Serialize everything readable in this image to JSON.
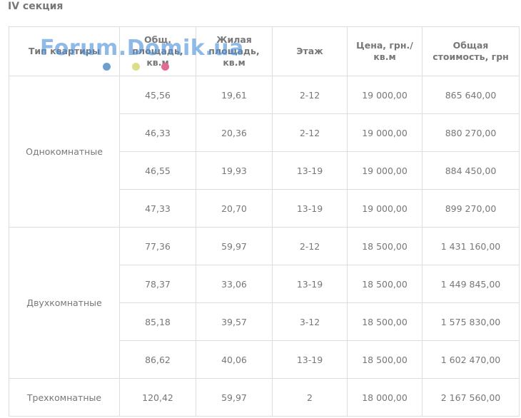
{
  "section_title": "IV секция",
  "watermark": "Forum.Domik.ua",
  "headers": {
    "type": "Тип квартиры",
    "total_area": "Общ. площадь, кв.м",
    "living_area": "Жилая площадь, кв.м",
    "floor": "Этаж",
    "price": "Цена, грн./ кв.м",
    "total_cost": "Общая стоимость, грн"
  },
  "groups": [
    {
      "type": "Однокомнатные",
      "rows": [
        {
          "total_area": "45,56",
          "living_area": "19,61",
          "floor": "2-12",
          "price": "19 000,00",
          "total_cost": "865 640,00"
        },
        {
          "total_area": "46,33",
          "living_area": "20,36",
          "floor": "2-12",
          "price": "19 000,00",
          "total_cost": "880 270,00"
        },
        {
          "total_area": "46,55",
          "living_area": "19,93",
          "floor": "13-19",
          "price": "19 000,00",
          "total_cost": "884 450,00"
        },
        {
          "total_area": "47,33",
          "living_area": "20,70",
          "floor": "13-19",
          "price": "19 000,00",
          "total_cost": "899 270,00"
        }
      ]
    },
    {
      "type": "Двухкомнатные",
      "rows": [
        {
          "total_area": "77,36",
          "living_area": "59,97",
          "floor": "2-12",
          "price": "18 500,00",
          "total_cost": "1 431 160,00"
        },
        {
          "total_area": "78,37",
          "living_area": "33,06",
          "floor": "13-19",
          "price": "18 500,00",
          "total_cost": "1 449 845,00"
        },
        {
          "total_area": "85,18",
          "living_area": "39,57",
          "floor": "3-12",
          "price": "18 500,00",
          "total_cost": "1 575 830,00"
        },
        {
          "total_area": "86,62",
          "living_area": "40,06",
          "floor": "13-19",
          "price": "18 500,00",
          "total_cost": "1 602 470,00"
        }
      ]
    },
    {
      "type": "Трехкомнатные",
      "rows": [
        {
          "total_area": "120,42",
          "living_area": "59,97",
          "floor": "2",
          "price": "18 000,00",
          "total_cost": "2 167 560,00"
        }
      ]
    }
  ]
}
